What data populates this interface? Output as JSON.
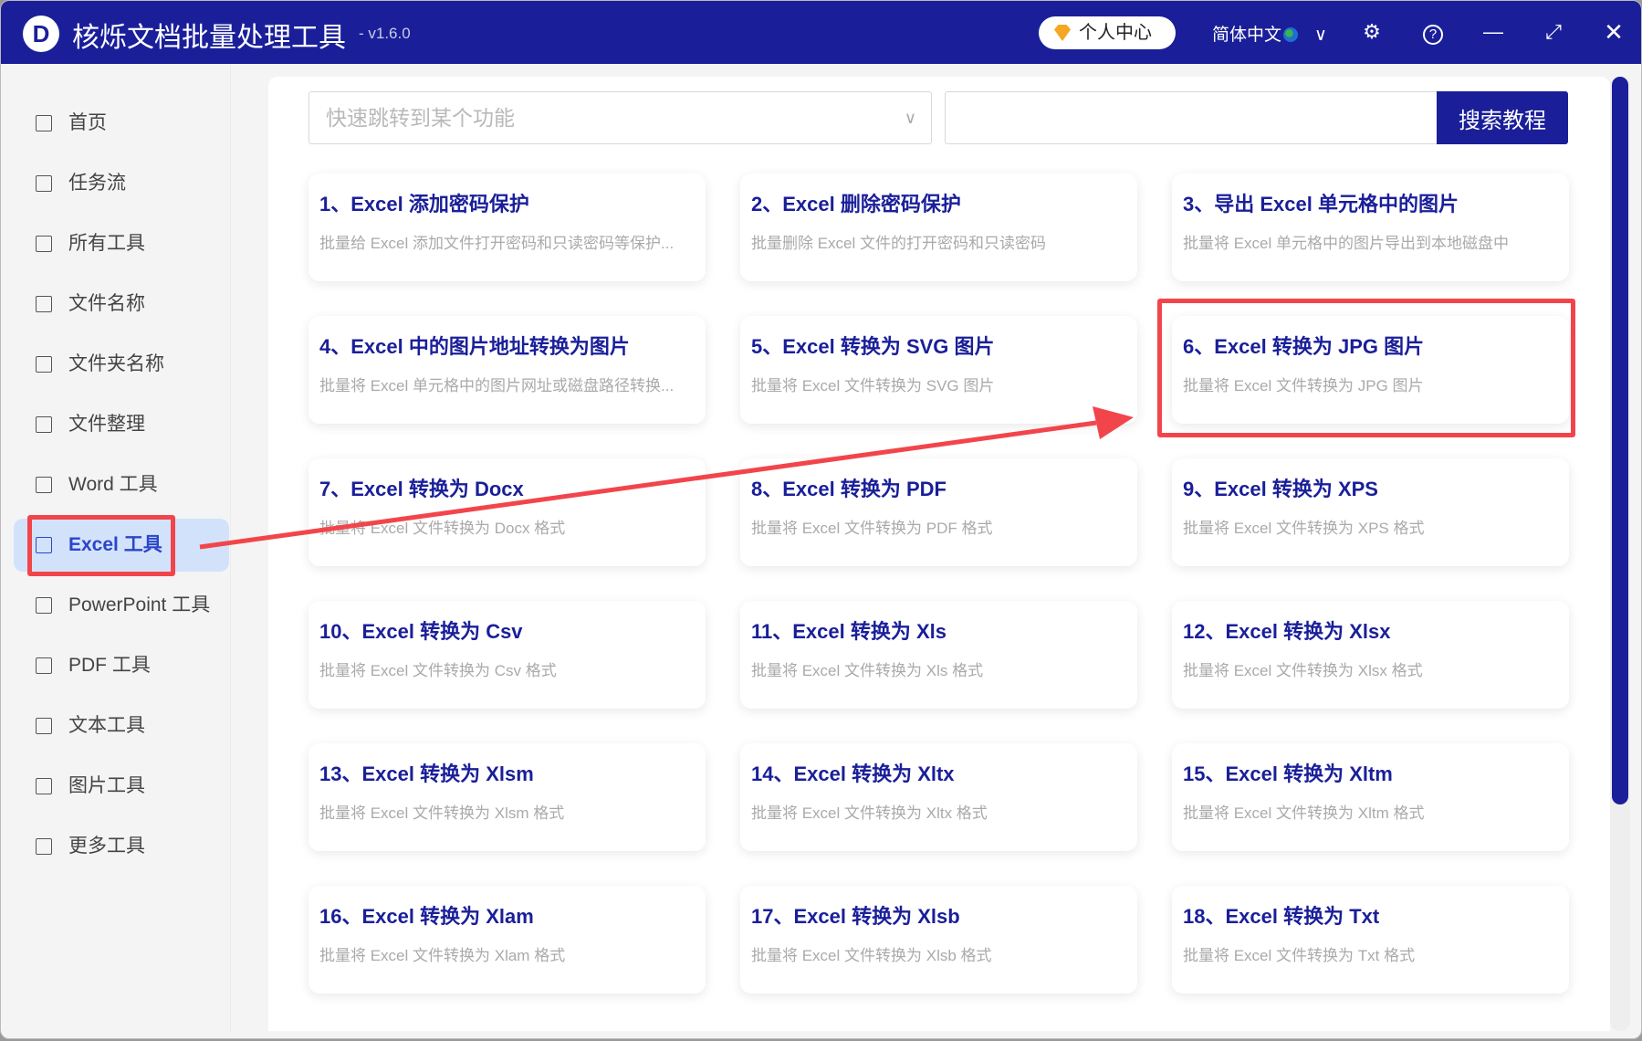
{
  "app": {
    "logo_letter": "D",
    "title": "核烁文档批量处理工具",
    "version": "- v1.6.0",
    "user_center": "个人中心",
    "language": "简体中文"
  },
  "sidebar": {
    "items": [
      {
        "label": "首页",
        "icon": "home-icon"
      },
      {
        "label": "任务流",
        "icon": "workflow-icon"
      },
      {
        "label": "所有工具",
        "icon": "monitor-icon"
      },
      {
        "label": "文件名称",
        "icon": "file-name-icon"
      },
      {
        "label": "文件夹名称",
        "icon": "folder-icon"
      },
      {
        "label": "文件整理",
        "icon": "organize-icon"
      },
      {
        "label": "Word 工具",
        "icon": "word-file-icon"
      },
      {
        "label": "Excel 工具",
        "icon": "excel-file-icon",
        "active": true
      },
      {
        "label": "PowerPoint 工具",
        "icon": "ppt-file-icon"
      },
      {
        "label": "PDF 工具",
        "icon": "pdf-file-icon"
      },
      {
        "label": "文本工具",
        "icon": "text-file-icon"
      },
      {
        "label": "图片工具",
        "icon": "image-icon"
      },
      {
        "label": "更多工具",
        "icon": "grid-icon"
      }
    ]
  },
  "search": {
    "jump_placeholder": "快速跳转到某个功能",
    "input_value": "",
    "button": "搜索教程"
  },
  "cards": [
    {
      "title": "1、Excel 添加密码保护",
      "desc": "批量给 Excel 添加文件打开密码和只读密码等保护..."
    },
    {
      "title": "2、Excel 删除密码保护",
      "desc": "批量删除 Excel 文件的打开密码和只读密码"
    },
    {
      "title": "3、导出 Excel 单元格中的图片",
      "desc": "批量将 Excel 单元格中的图片导出到本地磁盘中"
    },
    {
      "title": "4、Excel 中的图片地址转换为图片",
      "desc": "批量将 Excel 单元格中的图片网址或磁盘路径转换..."
    },
    {
      "title": "5、Excel 转换为 SVG 图片",
      "desc": "批量将 Excel 文件转换为 SVG 图片"
    },
    {
      "title": "6、Excel 转换为 JPG 图片",
      "desc": "批量将 Excel 文件转换为 JPG 图片"
    },
    {
      "title": "7、Excel 转换为 Docx",
      "desc": "批量将 Excel 文件转换为 Docx 格式"
    },
    {
      "title": "8、Excel 转换为 PDF",
      "desc": "批量将 Excel 文件转换为 PDF 格式"
    },
    {
      "title": "9、Excel 转换为 XPS",
      "desc": "批量将 Excel 文件转换为 XPS 格式"
    },
    {
      "title": "10、Excel 转换为 Csv",
      "desc": "批量将 Excel 文件转换为 Csv 格式"
    },
    {
      "title": "11、Excel 转换为 Xls",
      "desc": "批量将 Excel 文件转换为 Xls 格式"
    },
    {
      "title": "12、Excel 转换为 Xlsx",
      "desc": "批量将 Excel 文件转换为 Xlsx 格式"
    },
    {
      "title": "13、Excel 转换为 Xlsm",
      "desc": "批量将 Excel 文件转换为 Xlsm 格式"
    },
    {
      "title": "14、Excel 转换为 Xltx",
      "desc": "批量将 Excel 文件转换为 Xltx 格式"
    },
    {
      "title": "15、Excel 转换为 Xltm",
      "desc": "批量将 Excel 文件转换为 Xltm 格式"
    },
    {
      "title": "16、Excel 转换为 Xlam",
      "desc": "批量将 Excel 文件转换为 Xlam 格式"
    },
    {
      "title": "17、Excel 转换为 Xlsb",
      "desc": "批量将 Excel 文件转换为 Xlsb 格式"
    },
    {
      "title": "18、Excel 转换为 Txt",
      "desc": "批量将 Excel 文件转换为 Txt 格式"
    }
  ],
  "colors": {
    "brand": "#1a1f99",
    "annotation": "#f2454b",
    "active_bg": "#d3e2fb"
  }
}
